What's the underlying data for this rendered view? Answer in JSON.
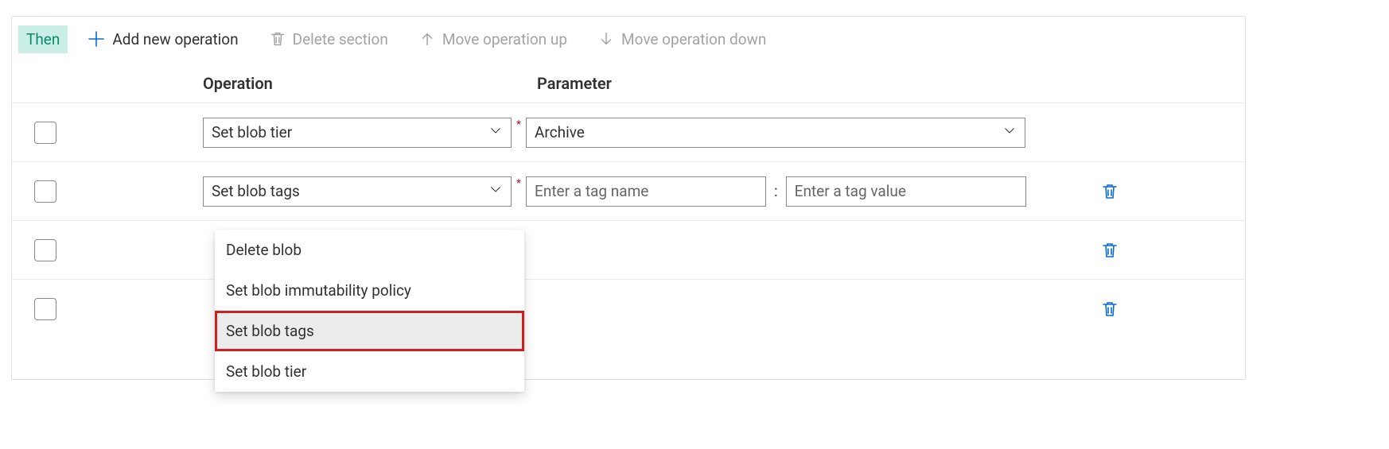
{
  "toolbar": {
    "then_label": "Then",
    "add_label": "Add new operation",
    "delete_label": "Delete section",
    "move_up_label": "Move operation up",
    "move_down_label": "Move operation down"
  },
  "headers": {
    "operation": "Operation",
    "parameter": "Parameter"
  },
  "rows": {
    "r0": {
      "operation": "Set blob tier",
      "parameter": "Archive"
    },
    "r1": {
      "operation": "Set blob tags",
      "tag_name_placeholder": "Enter a tag name",
      "tag_value_placeholder": "Enter a tag value"
    },
    "r2": {},
    "r3": {}
  },
  "dropdown": {
    "i0": "Delete blob",
    "i1": "Set blob immutability policy",
    "i2": "Set blob tags",
    "i3": "Set blob tier"
  },
  "icons": {
    "plus_color": "#0b69d0",
    "trash_color": "#0b69d0",
    "disabled_color": "#a3a3a3"
  }
}
